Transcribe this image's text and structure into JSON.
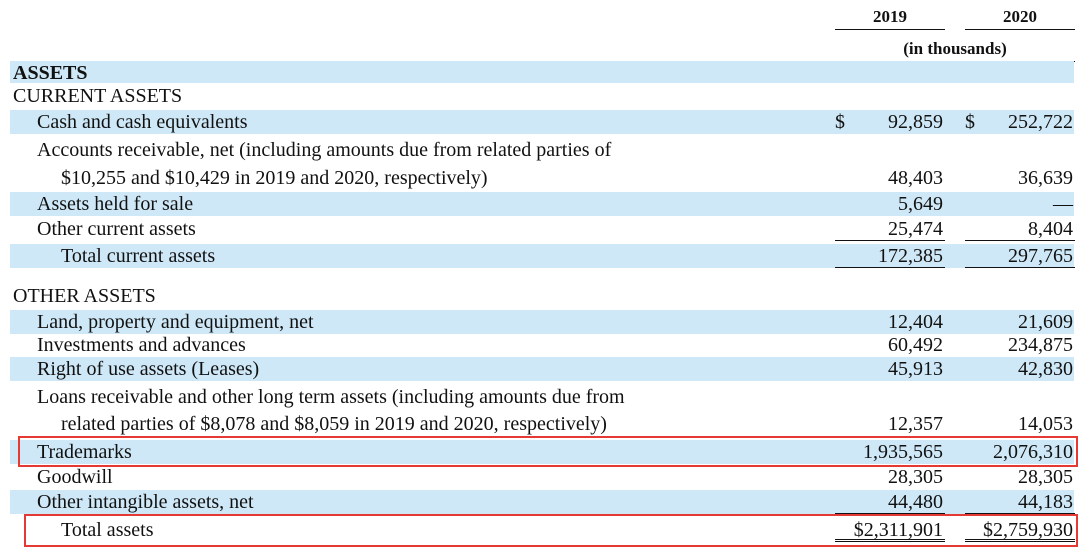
{
  "header": {
    "col1_label": "2019",
    "col2_label": "2020",
    "units": "(in thousands)"
  },
  "sections": {
    "assets_heading": "ASSETS",
    "current_assets_heading": "CURRENT ASSETS",
    "other_assets_heading": "OTHER ASSETS"
  },
  "rows": {
    "cash": {
      "label": "Cash and cash equivalents",
      "cur1": "$",
      "v2019": "92,859",
      "cur2": "$",
      "v2020": "252,722"
    },
    "ar_line1": {
      "label": "Accounts receivable, net (including amounts due from related parties of"
    },
    "ar_line2": {
      "label": "$10,255 and $10,429 in 2019 and 2020, respectively)",
      "v2019": "48,403",
      "v2020": "36,639"
    },
    "held_for_sale": {
      "label": "Assets held for sale",
      "v2019": "5,649",
      "v2020": "—"
    },
    "other_current": {
      "label": "Other current assets",
      "v2019": "25,474",
      "v2020": "8,404"
    },
    "total_current": {
      "label": "Total current assets",
      "v2019": "172,385",
      "v2020": "297,765"
    },
    "land": {
      "label": "Land, property and equipment, net",
      "v2019": "12,404",
      "v2020": "21,609"
    },
    "investments": {
      "label": "Investments and advances",
      "v2019": "60,492",
      "v2020": "234,875"
    },
    "rou": {
      "label": "Right of use assets (Leases)",
      "v2019": "45,913",
      "v2020": "42,830"
    },
    "loans_line1": {
      "label": "Loans receivable and other long term assets (including amounts due from"
    },
    "loans_line2": {
      "label": "related parties of $8,078 and $8,059 in 2019 and 2020, respectively)",
      "v2019": "12,357",
      "v2020": "14,053"
    },
    "trademarks": {
      "label": "Trademarks",
      "v2019": "1,935,565",
      "v2020": "2,076,310"
    },
    "goodwill": {
      "label": "Goodwill",
      "v2019": "28,305",
      "v2020": "28,305"
    },
    "other_intangible": {
      "label": "Other intangible assets, net",
      "v2019": "44,480",
      "v2020": "44,183"
    },
    "total_assets": {
      "label": "Total assets",
      "v2019": "$2,311,901",
      "v2020": "$2,759,930"
    }
  },
  "highlight_color": "#e53935"
}
